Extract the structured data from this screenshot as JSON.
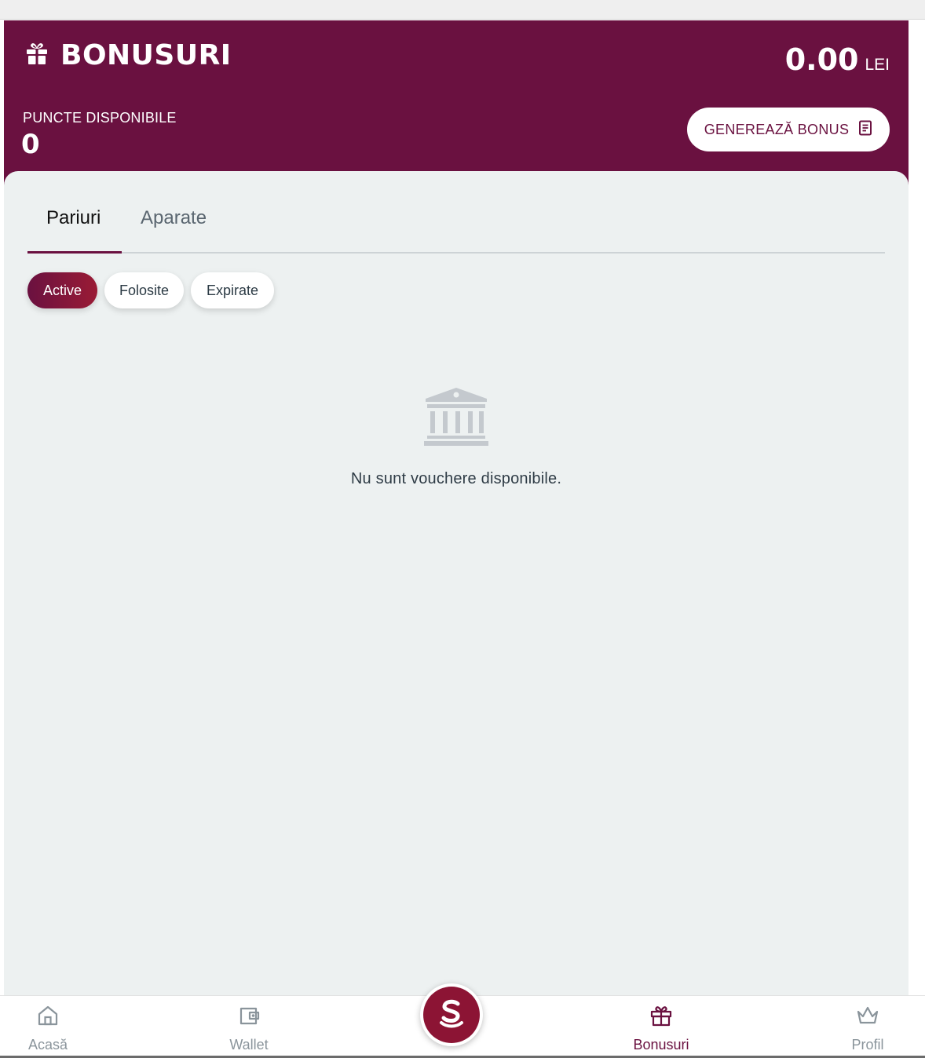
{
  "header": {
    "title": "BONUSURI",
    "title_icon": "gift-icon",
    "balance_amount": "0.00",
    "balance_currency": "LEI",
    "points_label": "PUNCTE DISPONIBILE",
    "points_value": "0",
    "generate_button_label": "GENEREAZĂ BONUS",
    "generate_button_icon": "document-icon"
  },
  "tabs": [
    {
      "label": "Pariuri",
      "active": true
    },
    {
      "label": "Aparate",
      "active": false
    }
  ],
  "filters": [
    {
      "label": "Active",
      "active": true
    },
    {
      "label": "Folosite",
      "active": false
    },
    {
      "label": "Expirate",
      "active": false
    }
  ],
  "empty_state": {
    "icon": "bank-icon",
    "message": "Nu sunt vouchere disponibile."
  },
  "bottom_nav": {
    "items": [
      {
        "label": "Acasă",
        "icon": "home-icon",
        "active": false
      },
      {
        "label": "Wallet",
        "icon": "wallet-icon",
        "active": false
      },
      {
        "label": "Bonusuri",
        "icon": "gift-icon",
        "active": true
      },
      {
        "label": "Profil",
        "icon": "crown-icon",
        "active": false
      }
    ],
    "center_icon": "s-logo-icon"
  },
  "colors": {
    "brand": "#6a1140",
    "accent": "#8c1434",
    "background": "#edf1f1"
  }
}
